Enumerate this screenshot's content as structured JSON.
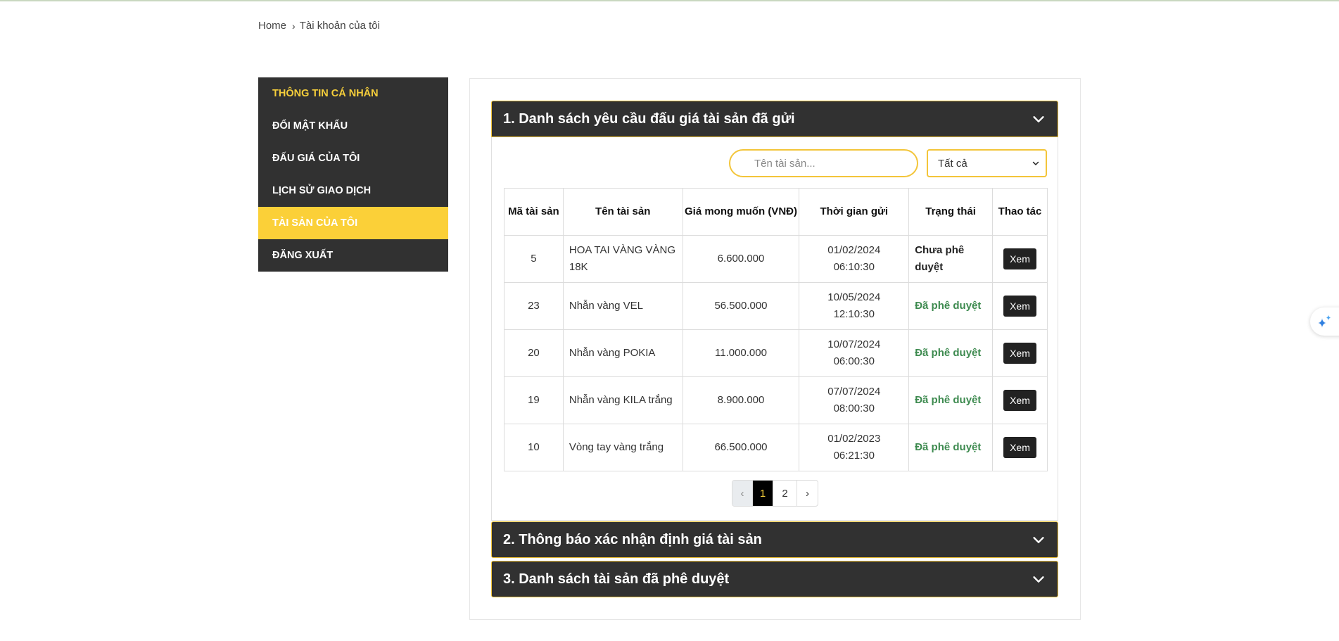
{
  "breadcrumb": {
    "home": "Home",
    "current": "Tài khoản của tôi"
  },
  "sidebar": {
    "items": [
      {
        "label": "THÔNG TIN CÁ NHÂN"
      },
      {
        "label": "ĐỔI MẬT KHẨU"
      },
      {
        "label": "ĐẤU GIÁ CỦA TÔI"
      },
      {
        "label": "LỊCH SỬ GIAO DỊCH"
      },
      {
        "label": "TÀI SẢN CỦA TÔI"
      },
      {
        "label": "ĐĂNG XUẤT"
      }
    ]
  },
  "sections": [
    {
      "title": "1. Danh sách yêu cầu đấu giá tài sản đã gửi"
    },
    {
      "title": "2. Thông báo xác nhận định giá tài sản"
    },
    {
      "title": "3. Danh sách tài sản đã phê duyệt"
    }
  ],
  "filters": {
    "search_placeholder": "Tên tài sản...",
    "status_selected": "Tất cả"
  },
  "table": {
    "headers": [
      "Mã tài sản",
      "Tên tài sản",
      "Giá mong muốn (VNĐ)",
      "Thời gian gửi",
      "Trạng thái",
      "Thao tác"
    ],
    "rows": [
      {
        "id": "5",
        "name": "HOA TAI VÀNG VÀNG 18K",
        "price": "6.600.000",
        "date": "01/02/2024",
        "time": "06:10:30",
        "status": "Chưa phê duyệt",
        "action": "Xem"
      },
      {
        "id": "23",
        "name": "Nhẫn vàng VEL",
        "price": "56.500.000",
        "date": "10/05/2024",
        "time": "12:10:30",
        "status": "Đã phê duyệt",
        "action": "Xem"
      },
      {
        "id": "20",
        "name": "Nhẫn vàng POKIA",
        "price": "11.000.000",
        "date": "10/07/2024",
        "time": "06:00:30",
        "status": "Đã phê duyệt",
        "action": "Xem"
      },
      {
        "id": "19",
        "name": "Nhẫn vàng KILA trắng",
        "price": "8.900.000",
        "date": "07/07/2024",
        "time": "08:00:30",
        "status": "Đã phê duyệt",
        "action": "Xem"
      },
      {
        "id": "10",
        "name": "Vòng tay vàng trắng",
        "price": "66.500.000",
        "date": "01/02/2023",
        "time": "06:21:30",
        "status": "Đã phê duyệt",
        "action": "Xem"
      }
    ]
  },
  "pagination": {
    "prev": "‹",
    "pages": [
      "1",
      "2"
    ],
    "next": "›",
    "current": "1"
  },
  "colors": {
    "dark": "#313131",
    "accent": "#fbd038",
    "approved": "#3d8a4f"
  },
  "icons": {
    "chevron": "chevron-down-icon",
    "float": "sparkle-icon"
  }
}
